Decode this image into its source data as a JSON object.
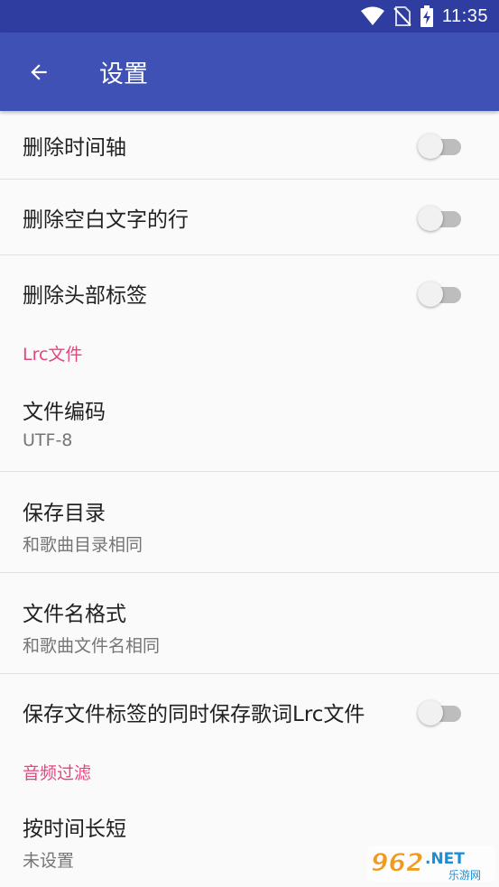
{
  "status_bar": {
    "time": "11:35",
    "icons": [
      "wifi-icon",
      "no-sim-icon",
      "battery-charging-icon"
    ]
  },
  "app_bar": {
    "title": "设置",
    "back_icon": "arrow-back-icon",
    "color": "#3f51b5"
  },
  "settings": {
    "remove_timeline": {
      "title": "删除时间轴",
      "enabled": false
    },
    "remove_blank_lines": {
      "title": "删除空白文字的行",
      "enabled": false
    },
    "remove_header_tags": {
      "title": "删除头部标签",
      "enabled": false
    },
    "lrc_category": "Lrc文件",
    "file_encoding": {
      "title": "文件编码",
      "summary": "UTF-8"
    },
    "save_directory": {
      "title": "保存目录",
      "summary": "和歌曲目录相同"
    },
    "file_name_format": {
      "title": "文件名格式",
      "summary": "和歌曲文件名相同"
    },
    "save_lrc_with_tags": {
      "title": "保存文件标签的同时保存歌词Lrc文件",
      "enabled": false
    },
    "audio_filter_category": "音频过滤",
    "by_duration": {
      "title": "按时间长短",
      "summary": "未设置"
    }
  },
  "watermark": {
    "text": "962",
    "suffix": ".NET",
    "sub": "乐游网"
  },
  "colors": {
    "accent": "#e5457f",
    "status_bar": "#2f3da0"
  }
}
